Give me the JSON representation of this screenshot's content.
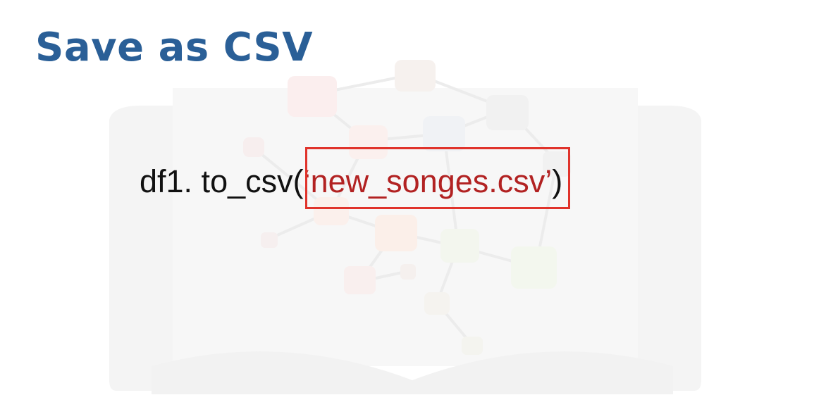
{
  "slide": {
    "title": "Save as CSV",
    "code": {
      "prefix": "df1. to_csv(",
      "argument": "‘new_songes.csv’",
      "suffix": ")"
    },
    "colors": {
      "title": "#2a5f97",
      "code_text": "#111111",
      "argument_text": "#b22222",
      "highlight_box": "#e0332b"
    }
  }
}
